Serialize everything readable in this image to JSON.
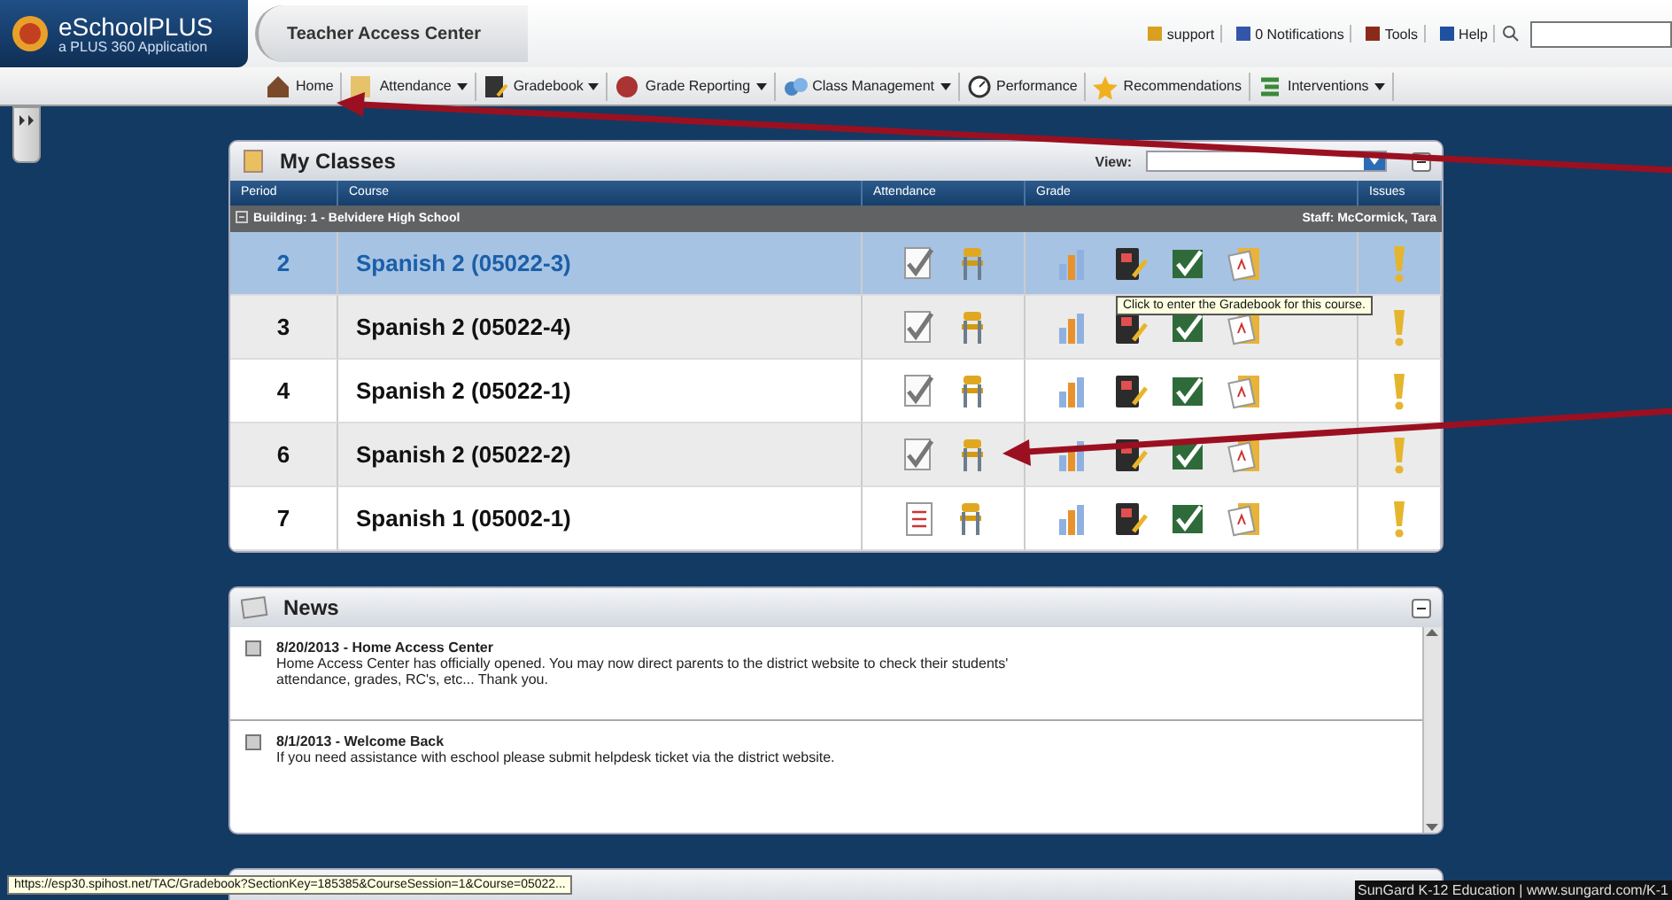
{
  "header": {
    "logo_title": "eSchoolPLUS",
    "logo_subtitle": "a PLUS 360 Application",
    "title": "Teacher Access Center",
    "links": [
      "support",
      "0 Notifications",
      "Tools",
      "Help"
    ]
  },
  "nav": [
    {
      "label": "Home",
      "dropdown": false
    },
    {
      "label": "Attendance",
      "dropdown": true
    },
    {
      "label": "Gradebook",
      "dropdown": true
    },
    {
      "label": "Grade Reporting",
      "dropdown": true
    },
    {
      "label": "Class Management",
      "dropdown": true
    },
    {
      "label": "Performance",
      "dropdown": false
    },
    {
      "label": "Recommendations",
      "dropdown": false
    },
    {
      "label": "Interventions",
      "dropdown": true
    }
  ],
  "my_classes": {
    "title": "My Classes",
    "view_label": "View:",
    "columns": [
      "Period",
      "Course",
      "Attendance",
      "Grade",
      "Issues"
    ],
    "group": {
      "building": "Building: 1 - Belvidere High School",
      "staff": "Staff: McCormick, Tara",
      "expanded": true
    },
    "rows": [
      {
        "period": "2",
        "course": "Spanish 2 (05022-3)",
        "selected": true,
        "kind": "checked"
      },
      {
        "period": "3",
        "course": "Spanish 2 (05022-4)",
        "selected": false,
        "kind": "checked"
      },
      {
        "period": "4",
        "course": "Spanish 2 (05022-1)",
        "selected": false,
        "kind": "checked"
      },
      {
        "period": "6",
        "course": "Spanish 2 (05022-2)",
        "selected": false,
        "kind": "checked"
      },
      {
        "period": "7",
        "course": "Spanish 1 (05002-1)",
        "selected": false,
        "kind": "list"
      }
    ],
    "tooltip": "Click to enter the Gradebook for this course."
  },
  "news": {
    "title": "News",
    "items": [
      {
        "title": "8/20/2013 - Home Access Center",
        "body": "Home Access Center has officially opened. You may now direct parents to the district website to check their students' attendance, grades, RC's, etc... Thank you."
      },
      {
        "title": "8/1/2013 - Welcome Back",
        "body": "If you need assistance with eschool please submit helpdesk ticket via the district website."
      }
    ]
  },
  "status_url": "https://esp30.spihost.net/TAC/Gradebook?SectionKey=185385&CourseSession=1&Course=05022...",
  "footer": "SunGard K-12 Education | www.sungard.com/K-1"
}
